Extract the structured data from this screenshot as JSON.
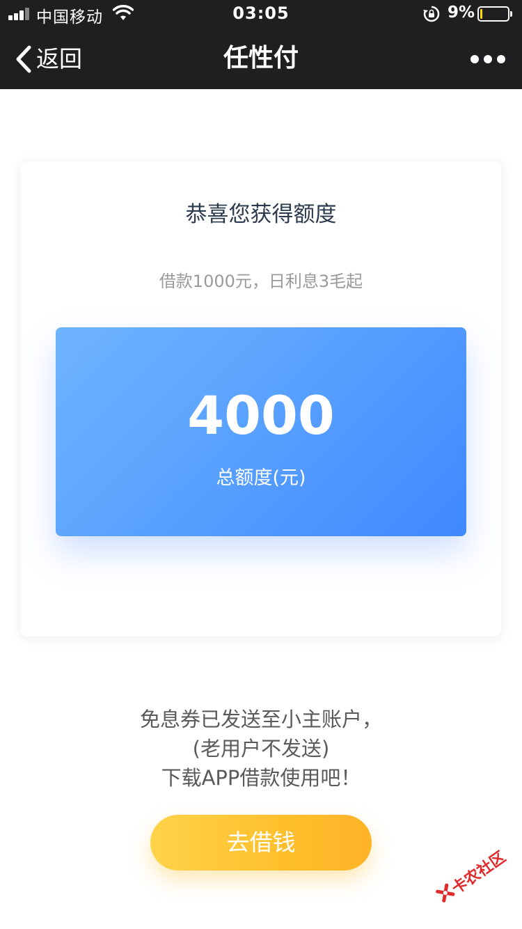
{
  "status_bar": {
    "carrier": "中国移动",
    "time": "03:05",
    "battery_percent": "9%",
    "battery_level": 0.09,
    "battery_color": "#ffd60a",
    "icons": [
      "signal-icon",
      "wifi-icon",
      "rotation-lock-icon",
      "battery-icon"
    ]
  },
  "nav": {
    "back_label": "返回",
    "title": "任性付",
    "more_icon": "more-dots-icon"
  },
  "card": {
    "title": "恭喜您获得额度",
    "subtitle": "借款1000元，日利息3毛起",
    "limit": {
      "amount": "4000",
      "label": "总额度(元)"
    }
  },
  "notice": {
    "line1": "免息券已发送至小主账户，",
    "line2": "(老用户不发送)",
    "line3": "下载APP借款使用吧！"
  },
  "action": {
    "borrow_label": "去借钱"
  },
  "watermark": {
    "text": "卡农社区"
  },
  "colors": {
    "nav_bg": "#1f1f21",
    "limit_gradient_start": "#6eb4ff",
    "limit_gradient_end": "#3f88ff",
    "button_gradient_start": "#ffd34a",
    "button_gradient_end": "#ffb327",
    "watermark": "#e02a2a"
  }
}
